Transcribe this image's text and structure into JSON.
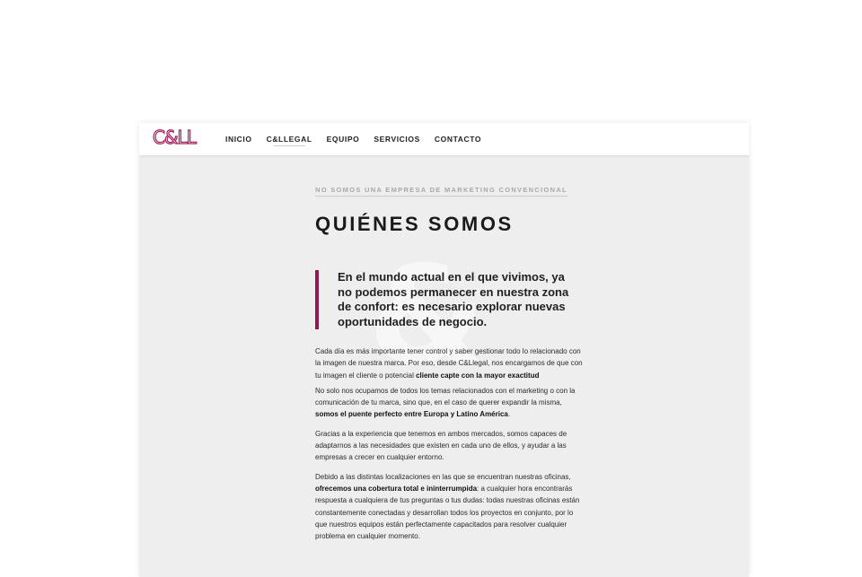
{
  "brand": {
    "logo_text": "C&LL",
    "accent": "#8e1a50"
  },
  "nav": {
    "items": [
      {
        "label": "INICIO"
      },
      {
        "label": "C&LLEGAL"
      },
      {
        "label": "EQUIPO"
      },
      {
        "label": "SERVICIOS"
      },
      {
        "label": "CONTACTO"
      }
    ],
    "active": "C&LLEGAL"
  },
  "hero": {
    "eyebrow": "NO SOMOS UNA EMPRESA DE MARKETING CONVENCIONAL",
    "title": "QUIÉNES SOMOS",
    "quote": "En el mundo actual en el que vivimos, ya no podemos permanecer en nuestra zona de confort: es necesario explorar nuevas oportunidades de negocio."
  },
  "body": {
    "p1_text": "Cada día es más importante tener control y saber gestionar todo lo relacionado con la imagen de nuestra marca. Por eso, desde C&Llegal, nos encargamos de que con tu imagen el cliente o potencial ",
    "p1_bold": "cliente capte con la mayor exactitud",
    "p2_text": "No solo nos ocupamos de todos los temas relacionados con el marketing o con la comunicación de tu marca, sino que, en el caso de querer expandir la misma, ",
    "p2_bold": "somos el puente perfecto entre Europa y Latino América",
    "p2_end": ".",
    "p3_text": "Gracias a la experiencia que tenemos en ambos mercados, somos capaces de adaptarnos a las necesidades que existen en cada uno de ellos, y ayudar a las empresas a crecer en cualquier entorno.",
    "p4_start": "Debido a las distintas localizaciones en las que se encuentran nuestras oficinas, ",
    "p4_bold": "ofrecemos una cobertura total e ininterrumpida",
    "p4_end": ": a cualquier hora encontrarás respuesta a cualquiera de tus preguntas o tus dudas: todas nuestras oficinas están constantemente conectadas y desarrollan todos los proyectos en conjunto, por lo que nuestros equipos están perfectamente capacitados para resolver cualquier problema en cualquier momento."
  }
}
